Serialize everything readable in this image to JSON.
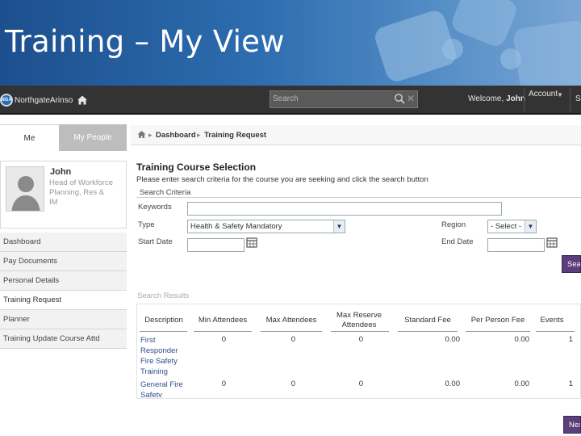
{
  "slide": {
    "title": "Training – My View"
  },
  "topbar": {
    "logo_text": "NorthgateArinso",
    "logo_badge": "NGA",
    "search_placeholder": "Search",
    "welcome_prefix": "Welcome, ",
    "welcome_name": "John",
    "account_label": "Account",
    "extra_label": "S"
  },
  "sidebar": {
    "tabs": [
      {
        "label": "Me"
      },
      {
        "label": "My People"
      }
    ],
    "profile": {
      "name": "John",
      "role": "Head of Workforce Planning, Res & IM"
    },
    "nav": [
      {
        "label": "Dashboard"
      },
      {
        "label": "Pay Documents"
      },
      {
        "label": "Personal Details"
      },
      {
        "label": "Training Request"
      },
      {
        "label": "Planner"
      },
      {
        "label": "Training Update Course Attd"
      }
    ]
  },
  "breadcrumb": {
    "items": [
      "Dashboard",
      "Training Request"
    ]
  },
  "form": {
    "title": "Training Course Selection",
    "instructions": "Please enter search criteria for the course you are seeking and click the search button",
    "section_label": "Search Criteria",
    "keywords_label": "Keywords",
    "keywords_value": "",
    "type_label": "Type",
    "type_value": "Health & Safety Mandatory",
    "region_label": "Region",
    "region_value": "- Select -",
    "start_date_label": "Start Date",
    "start_date_value": "",
    "end_date_label": "End Date",
    "end_date_value": "",
    "search_button": "Search"
  },
  "results": {
    "heading": "Search Results",
    "columns": [
      "Description",
      "Min Attendees",
      "Max Attendees",
      "Max Reserve Attendees",
      "Standard Fee",
      "Per Person Fee",
      "Events"
    ],
    "rows": [
      {
        "description": "First Responder Fire Safety Training",
        "min": "0",
        "max": "0",
        "reserve": "0",
        "standard_fee": "0.00",
        "per_person_fee": "0.00",
        "events": "1"
      },
      {
        "description": "General Fire Safety",
        "min": "0",
        "max": "0",
        "reserve": "0",
        "standard_fee": "0.00",
        "per_person_fee": "0.00",
        "events": "1"
      }
    ],
    "next_button": "Next"
  },
  "colors": {
    "accent": "#5b3f7a",
    "topbar": "#333333",
    "slide_header": "#2d6db0"
  }
}
